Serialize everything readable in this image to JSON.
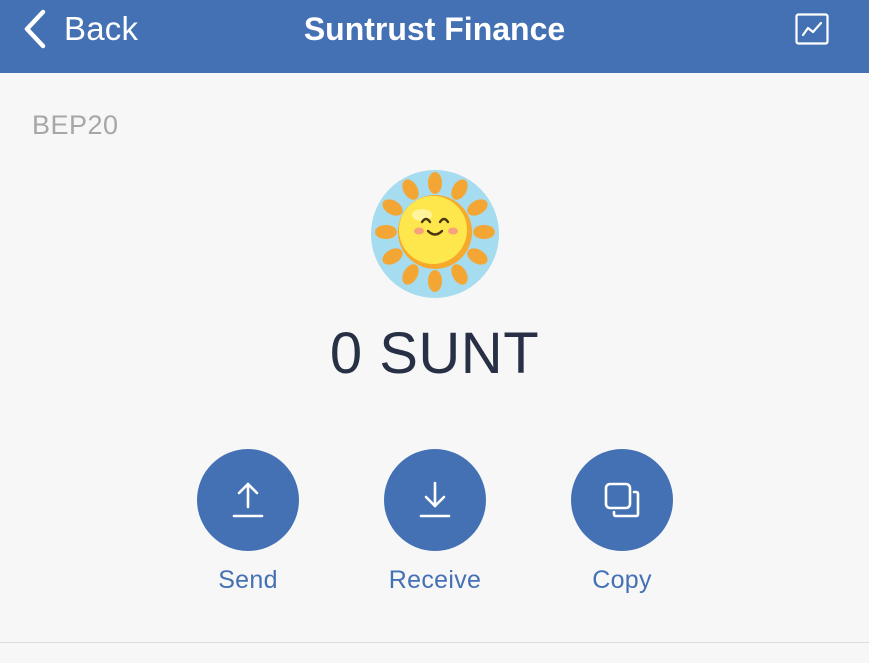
{
  "nav": {
    "back_label": "Back",
    "title": "Suntrust Finance",
    "chart_icon": "chart-line-icon",
    "back_icon": "chevron-left-icon"
  },
  "token": {
    "network": "BEP20",
    "logo_icon": "smiling-sun-icon",
    "balance": "0 SUNT"
  },
  "actions": [
    {
      "label": "Send",
      "icon": "upload-arrow-icon"
    },
    {
      "label": "Receive",
      "icon": "download-arrow-icon"
    },
    {
      "label": "Copy",
      "icon": "copy-icon"
    }
  ],
  "colors": {
    "accent": "#4471b4",
    "background": "#f7f7f7",
    "balance_text": "#283045",
    "muted_text": "#a7a7a7"
  }
}
